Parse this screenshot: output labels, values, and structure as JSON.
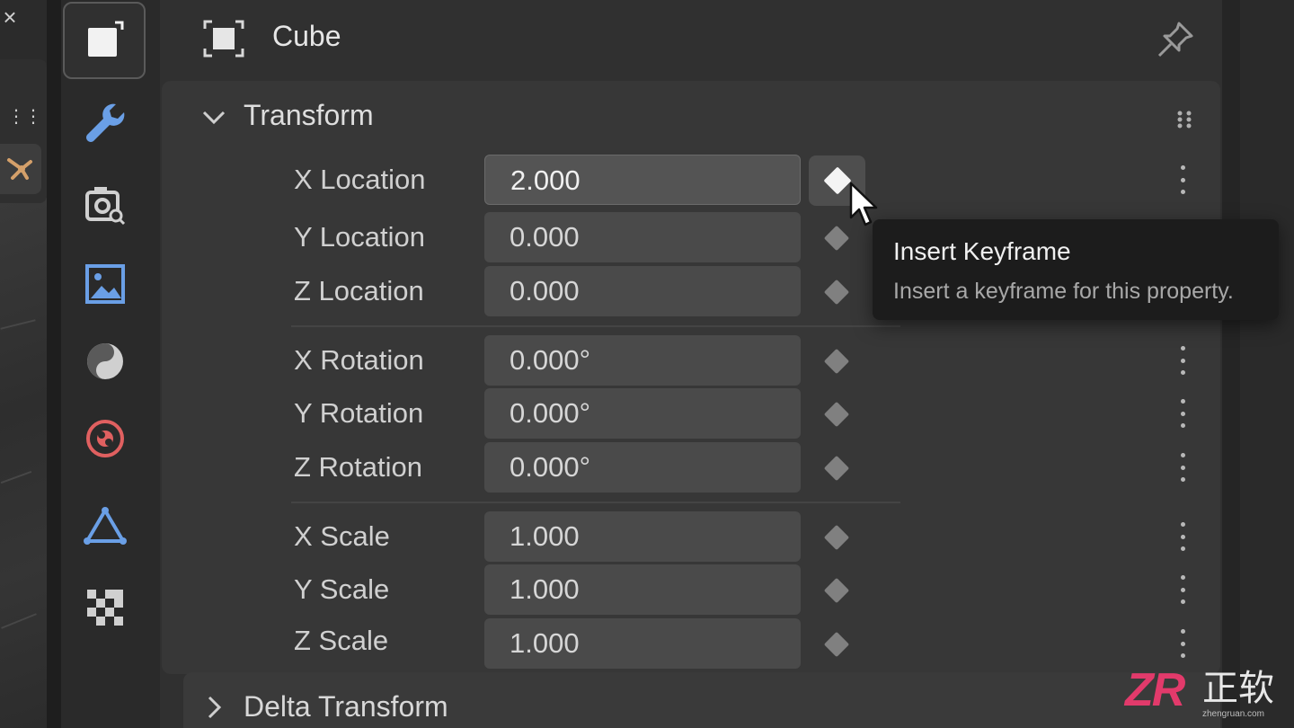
{
  "left_strip": {
    "close_label": "×",
    "dots_label": "⋮⋮⋮"
  },
  "tabs": [
    {
      "name": "object-tab",
      "icon": "object-square-icon",
      "active": true
    },
    {
      "name": "modifier-tab",
      "icon": "wrench-icon",
      "color": "#6a9fe6"
    },
    {
      "name": "render-tab",
      "icon": "camera-icon",
      "color": "#d0d0d0"
    },
    {
      "name": "output-tab",
      "icon": "image-icon",
      "color": "#6a9fe6"
    },
    {
      "name": "material-tab",
      "icon": "sphere-icon",
      "color": "#d0d0d0"
    },
    {
      "name": "physics-tab",
      "icon": "physics-icon",
      "color": "#e06060"
    },
    {
      "name": "data-tab",
      "icon": "triangle-icon",
      "color": "#6a9fe6"
    },
    {
      "name": "texture-tab",
      "icon": "checker-icon",
      "color": "#d0d0d0"
    }
  ],
  "header": {
    "title": "Cube",
    "icon": "object-frame-icon",
    "pin_icon": "pin-icon"
  },
  "transform": {
    "title": "Transform",
    "rows": [
      {
        "label": "X Location",
        "value": "2.000",
        "active": true
      },
      {
        "label": "Y Location",
        "value": "0.000"
      },
      {
        "label": "Z Location",
        "value": "0.000"
      },
      {
        "label": "X Rotation",
        "value": "0.000°"
      },
      {
        "label": "Y Rotation",
        "value": "0.000°"
      },
      {
        "label": "Z Rotation",
        "value": "0.000°"
      },
      {
        "label": "X Scale",
        "value": "1.000"
      },
      {
        "label": "Y Scale",
        "value": "1.000"
      },
      {
        "label": "Z Scale",
        "value": "1.000"
      }
    ]
  },
  "delta_transform": {
    "title": "Delta Transform"
  },
  "tooltip": {
    "title": "Insert Keyframe",
    "description": "Insert a keyframe for this property."
  },
  "watermark": {
    "logo": "ZR",
    "text": "正软",
    "url": "zhengruan.com"
  },
  "colors": {
    "panel_bg": "#303030",
    "section_bg": "#373737",
    "field_bg": "#4a4a4a",
    "tooltip_bg": "#1c1c1c",
    "keyframe_active": "#f4f4f4",
    "watermark_accent": "#e23a6b"
  }
}
